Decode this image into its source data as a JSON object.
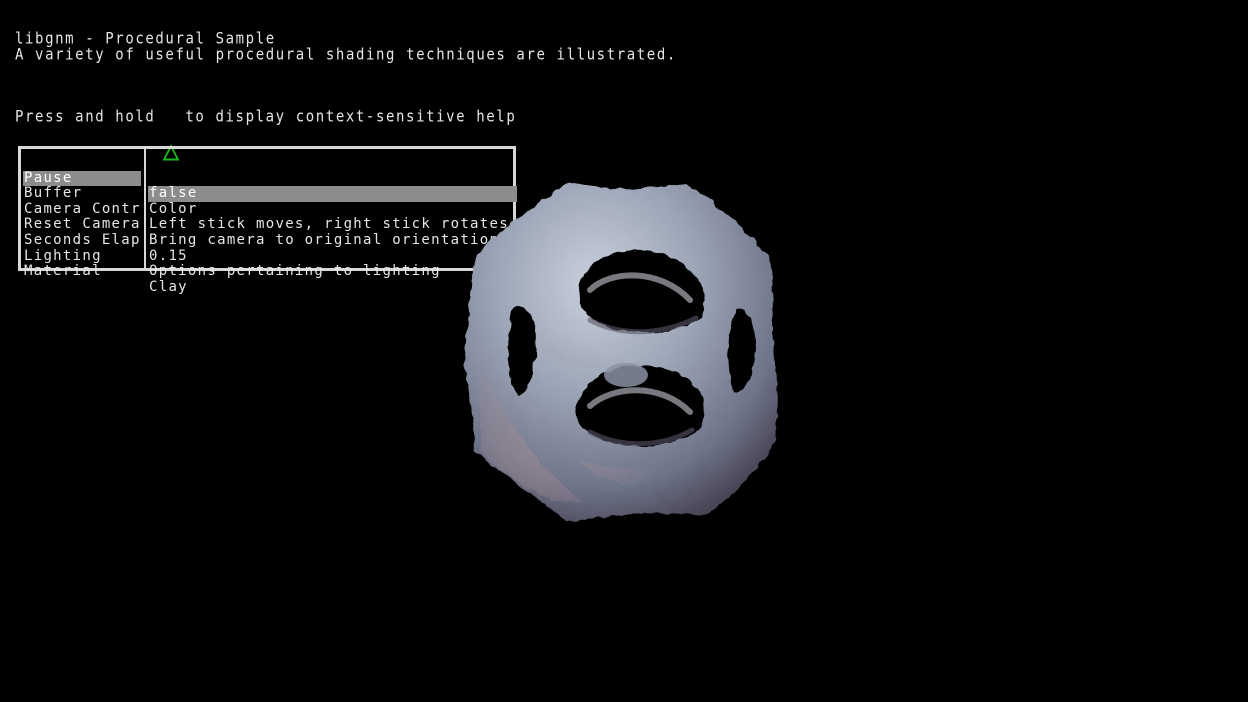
{
  "header": {
    "title": "libgnm - Procedural Sample",
    "subtitle": "A variety of useful procedural shading techniques are illustrated."
  },
  "help": {
    "prefix": "Press and hold",
    "button_icon": "triangle-button-icon",
    "suffix": "to display context-sensitive help",
    "button_color": "#1db51d"
  },
  "menu": {
    "rows": [
      {
        "label": "Pause",
        "value": "false",
        "selected": true
      },
      {
        "label": "Buffer",
        "value": "Color",
        "selected": false
      },
      {
        "label": "Camera Controls",
        "value": "Left stick moves, right stick rotates",
        "selected": false
      },
      {
        "label": "Reset Camera",
        "value": "Bring camera to original orientation",
        "selected": false
      },
      {
        "label": "Seconds Elapsed",
        "value": "0.15",
        "selected": false
      },
      {
        "label": "Lighting",
        "value": "Options pertaining to lighting",
        "selected": false
      },
      {
        "label": "Material",
        "value": "Clay",
        "selected": false
      }
    ],
    "highlight_color": "#8c8c8c",
    "border_color": "#d8d8d8"
  },
  "scene": {
    "object": "procedural-clay-lattice",
    "material_color": "#9aa3b4",
    "background_color": "#000000"
  }
}
